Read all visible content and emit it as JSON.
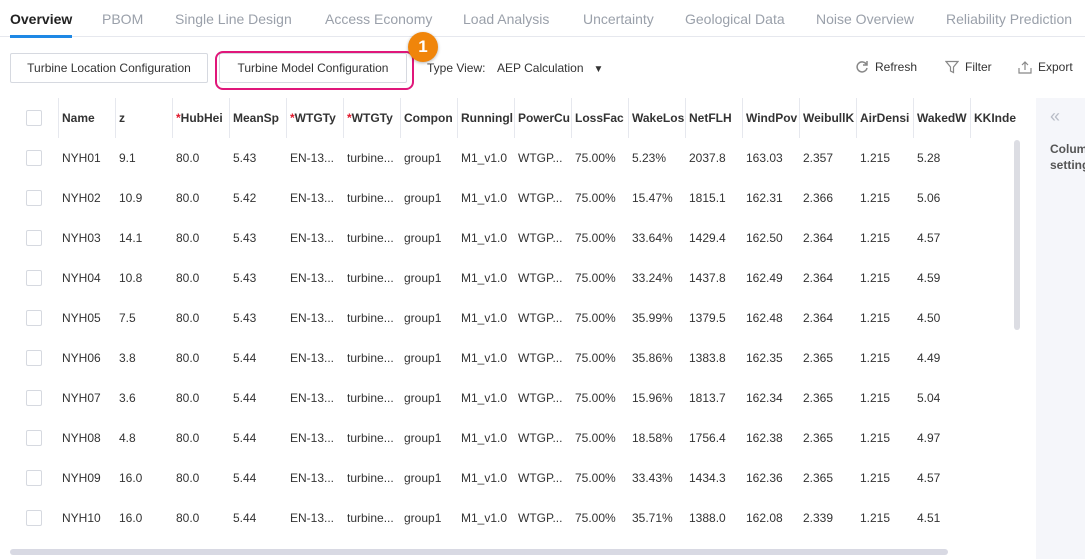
{
  "tabs": [
    {
      "label": "Overview",
      "active": true
    },
    {
      "label": "PBOM"
    },
    {
      "label": "Single Line Design"
    },
    {
      "label": "Access Economy"
    },
    {
      "label": "Load Analysis"
    },
    {
      "label": "Uncertainty"
    },
    {
      "label": "Geological Data"
    },
    {
      "label": "Noise Overview"
    },
    {
      "label": "Reliability Prediction"
    }
  ],
  "toolbar": {
    "location_btn": "Turbine Location Configuration",
    "model_btn": "Turbine Model Configuration",
    "badge": "1",
    "type_view_label": "Type View:",
    "type_view_value": "AEP Calculation",
    "refresh": "Refresh",
    "filter": "Filter",
    "export": "Export"
  },
  "colors": {
    "accent": "#1e88e5",
    "highlight": "#e0177a",
    "badge": "#f0850a"
  },
  "columns": [
    {
      "label": "Name"
    },
    {
      "label": "z"
    },
    {
      "label": "HubHei",
      "required": true
    },
    {
      "label": "MeanSp"
    },
    {
      "label": "WTGTy",
      "required": true
    },
    {
      "label": "WTGTy",
      "required": true
    },
    {
      "label": "Compon"
    },
    {
      "label": "Runningl"
    },
    {
      "label": "PowerCu"
    },
    {
      "label": "LossFac"
    },
    {
      "label": "WakeLos"
    },
    {
      "label": "NetFLH"
    },
    {
      "label": "WindPov"
    },
    {
      "label": "WeibullK"
    },
    {
      "label": "AirDensi"
    },
    {
      "label": "WakedW"
    },
    {
      "label": "KKInde"
    }
  ],
  "rows": [
    [
      "NYH01",
      "9.1",
      "80.0",
      "5.43",
      "EN-13...",
      "turbine...",
      "group1",
      "M1_v1.0",
      "WTGP...",
      "75.00%",
      "5.23%",
      "2037.8",
      "163.03",
      "2.357",
      "1.215",
      "5.28",
      ""
    ],
    [
      "NYH02",
      "10.9",
      "80.0",
      "5.42",
      "EN-13...",
      "turbine...",
      "group1",
      "M1_v1.0",
      "WTGP...",
      "75.00%",
      "15.47%",
      "1815.1",
      "162.31",
      "2.366",
      "1.215",
      "5.06",
      ""
    ],
    [
      "NYH03",
      "14.1",
      "80.0",
      "5.43",
      "EN-13...",
      "turbine...",
      "group1",
      "M1_v1.0",
      "WTGP...",
      "75.00%",
      "33.64%",
      "1429.4",
      "162.50",
      "2.364",
      "1.215",
      "4.57",
      ""
    ],
    [
      "NYH04",
      "10.8",
      "80.0",
      "5.43",
      "EN-13...",
      "turbine...",
      "group1",
      "M1_v1.0",
      "WTGP...",
      "75.00%",
      "33.24%",
      "1437.8",
      "162.49",
      "2.364",
      "1.215",
      "4.59",
      ""
    ],
    [
      "NYH05",
      "7.5",
      "80.0",
      "5.43",
      "EN-13...",
      "turbine...",
      "group1",
      "M1_v1.0",
      "WTGP...",
      "75.00%",
      "35.99%",
      "1379.5",
      "162.48",
      "2.364",
      "1.215",
      "4.50",
      ""
    ],
    [
      "NYH06",
      "3.8",
      "80.0",
      "5.44",
      "EN-13...",
      "turbine...",
      "group1",
      "M1_v1.0",
      "WTGP...",
      "75.00%",
      "35.86%",
      "1383.8",
      "162.35",
      "2.365",
      "1.215",
      "4.49",
      ""
    ],
    [
      "NYH07",
      "3.6",
      "80.0",
      "5.44",
      "EN-13...",
      "turbine...",
      "group1",
      "M1_v1.0",
      "WTGP...",
      "75.00%",
      "15.96%",
      "1813.7",
      "162.34",
      "2.365",
      "1.215",
      "5.04",
      ""
    ],
    [
      "NYH08",
      "4.8",
      "80.0",
      "5.44",
      "EN-13...",
      "turbine...",
      "group1",
      "M1_v1.0",
      "WTGP...",
      "75.00%",
      "18.58%",
      "1756.4",
      "162.38",
      "2.365",
      "1.215",
      "4.97",
      ""
    ],
    [
      "NYH09",
      "16.0",
      "80.0",
      "5.44",
      "EN-13...",
      "turbine...",
      "group1",
      "M1_v1.0",
      "WTGP...",
      "75.00%",
      "33.43%",
      "1434.3",
      "162.36",
      "2.365",
      "1.215",
      "4.57",
      ""
    ],
    [
      "NYH10",
      "16.0",
      "80.0",
      "5.44",
      "EN-13...",
      "turbine...",
      "group1",
      "M1_v1.0",
      "WTGP...",
      "75.00%",
      "35.71%",
      "1388.0",
      "162.08",
      "2.339",
      "1.215",
      "4.51",
      ""
    ]
  ],
  "side_panel": {
    "label": "Column\nsettings"
  }
}
